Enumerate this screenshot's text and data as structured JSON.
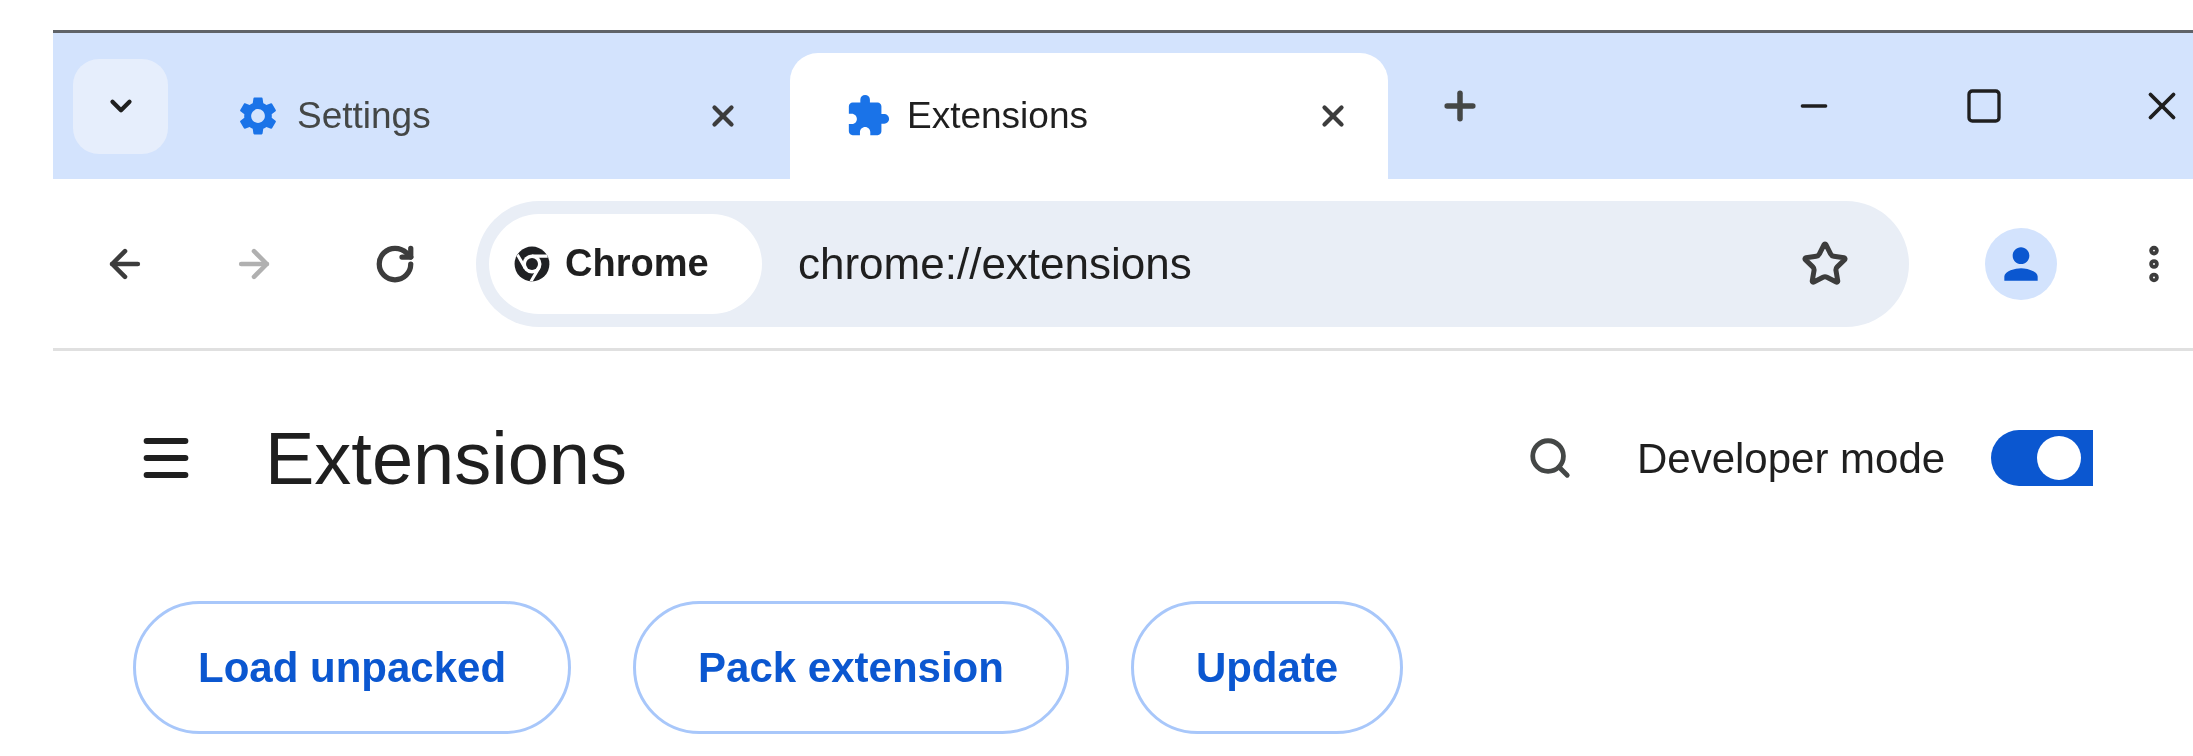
{
  "tabs": [
    {
      "title": "Settings",
      "kind": "gear",
      "selected": false
    },
    {
      "title": "Extensions",
      "kind": "puzzle",
      "selected": true
    }
  ],
  "toolbar": {
    "back": {
      "disabled": false
    },
    "forward": {
      "disabled": true
    },
    "omnibox": {
      "chip": "Chrome",
      "url": "chrome://extensions"
    }
  },
  "page": {
    "title": "Extensions",
    "developer_mode": {
      "label": "Developer mode",
      "on": true
    },
    "buttons": [
      "Load unpacked",
      "Pack extension",
      "Update"
    ]
  }
}
